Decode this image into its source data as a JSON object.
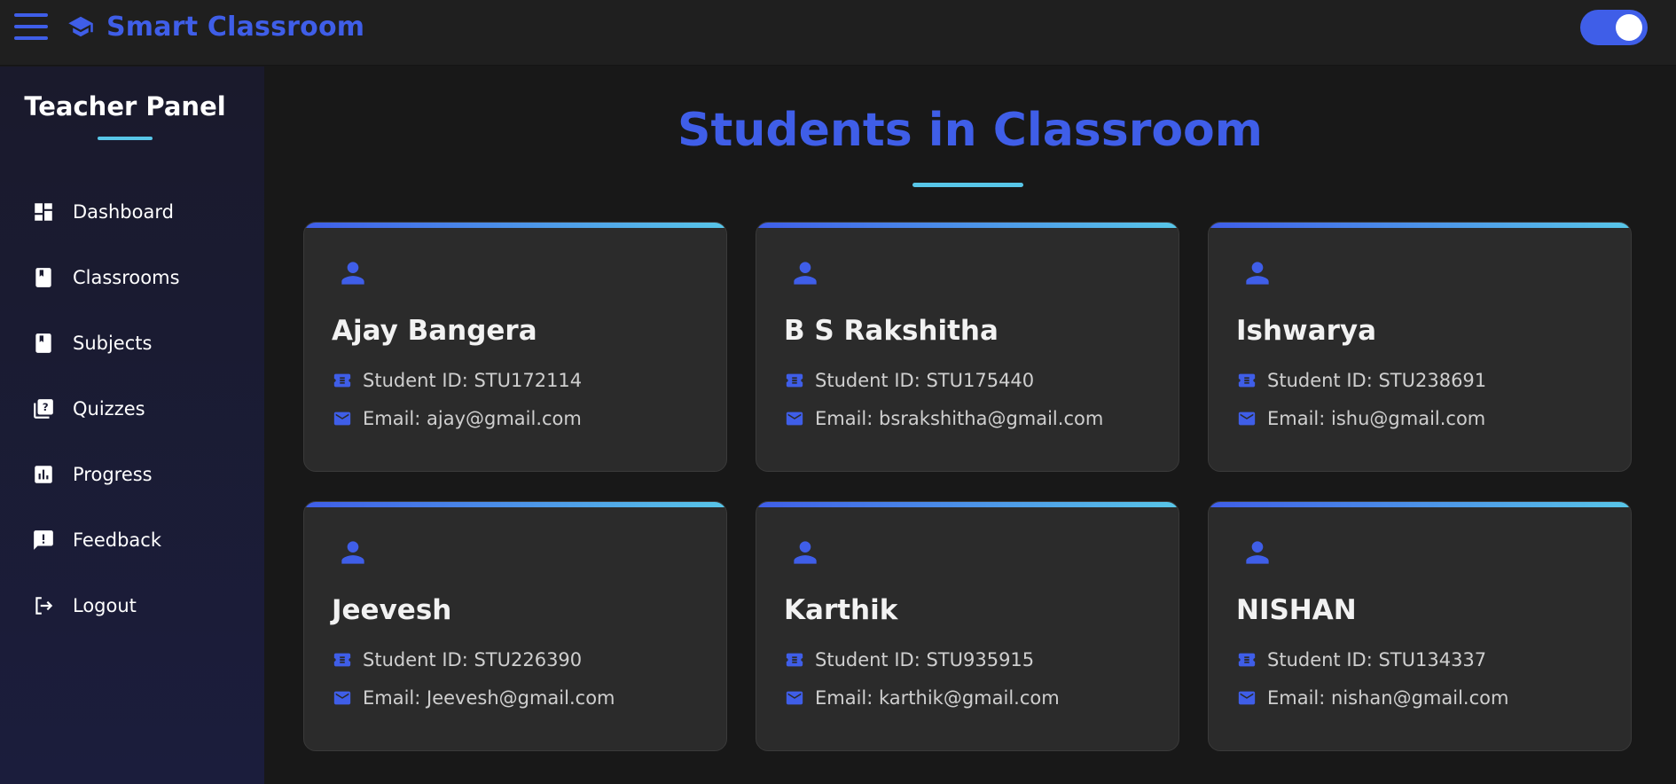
{
  "app": {
    "title": "Smart Classroom",
    "accent_color": "#3f5ee8",
    "secondary_accent": "#58c6e8",
    "theme_toggle_on": true
  },
  "sidebar": {
    "title": "Teacher Panel",
    "items": [
      {
        "label": "Dashboard",
        "icon": "dashboard-icon"
      },
      {
        "label": "Classrooms",
        "icon": "book-icon"
      },
      {
        "label": "Subjects",
        "icon": "book-icon"
      },
      {
        "label": "Quizzes",
        "icon": "quiz-icon"
      },
      {
        "label": "Progress",
        "icon": "bar-chart-icon"
      },
      {
        "label": "Feedback",
        "icon": "feedback-icon"
      },
      {
        "label": "Logout",
        "icon": "logout-icon"
      }
    ]
  },
  "main": {
    "title": "Students in Classroom",
    "students": [
      {
        "name": "Ajay Bangera",
        "id_text": "Student ID: STU172114",
        "email_text": "Email: ajay@gmail.com"
      },
      {
        "name": "B S Rakshitha",
        "id_text": "Student ID: STU175440",
        "email_text": "Email: bsrakshitha@gmail.com"
      },
      {
        "name": "Ishwarya",
        "id_text": "Student ID: STU238691",
        "email_text": "Email: ishu@gmail.com"
      },
      {
        "name": "Jeevesh",
        "id_text": "Student ID: STU226390",
        "email_text": "Email: Jeevesh@gmail.com"
      },
      {
        "name": "Karthik",
        "id_text": "Student ID: STU935915",
        "email_text": "Email: karthik@gmail.com"
      },
      {
        "name": "NISHAN",
        "id_text": "Student ID: STU134337",
        "email_text": "Email: nishan@gmail.com"
      }
    ]
  }
}
